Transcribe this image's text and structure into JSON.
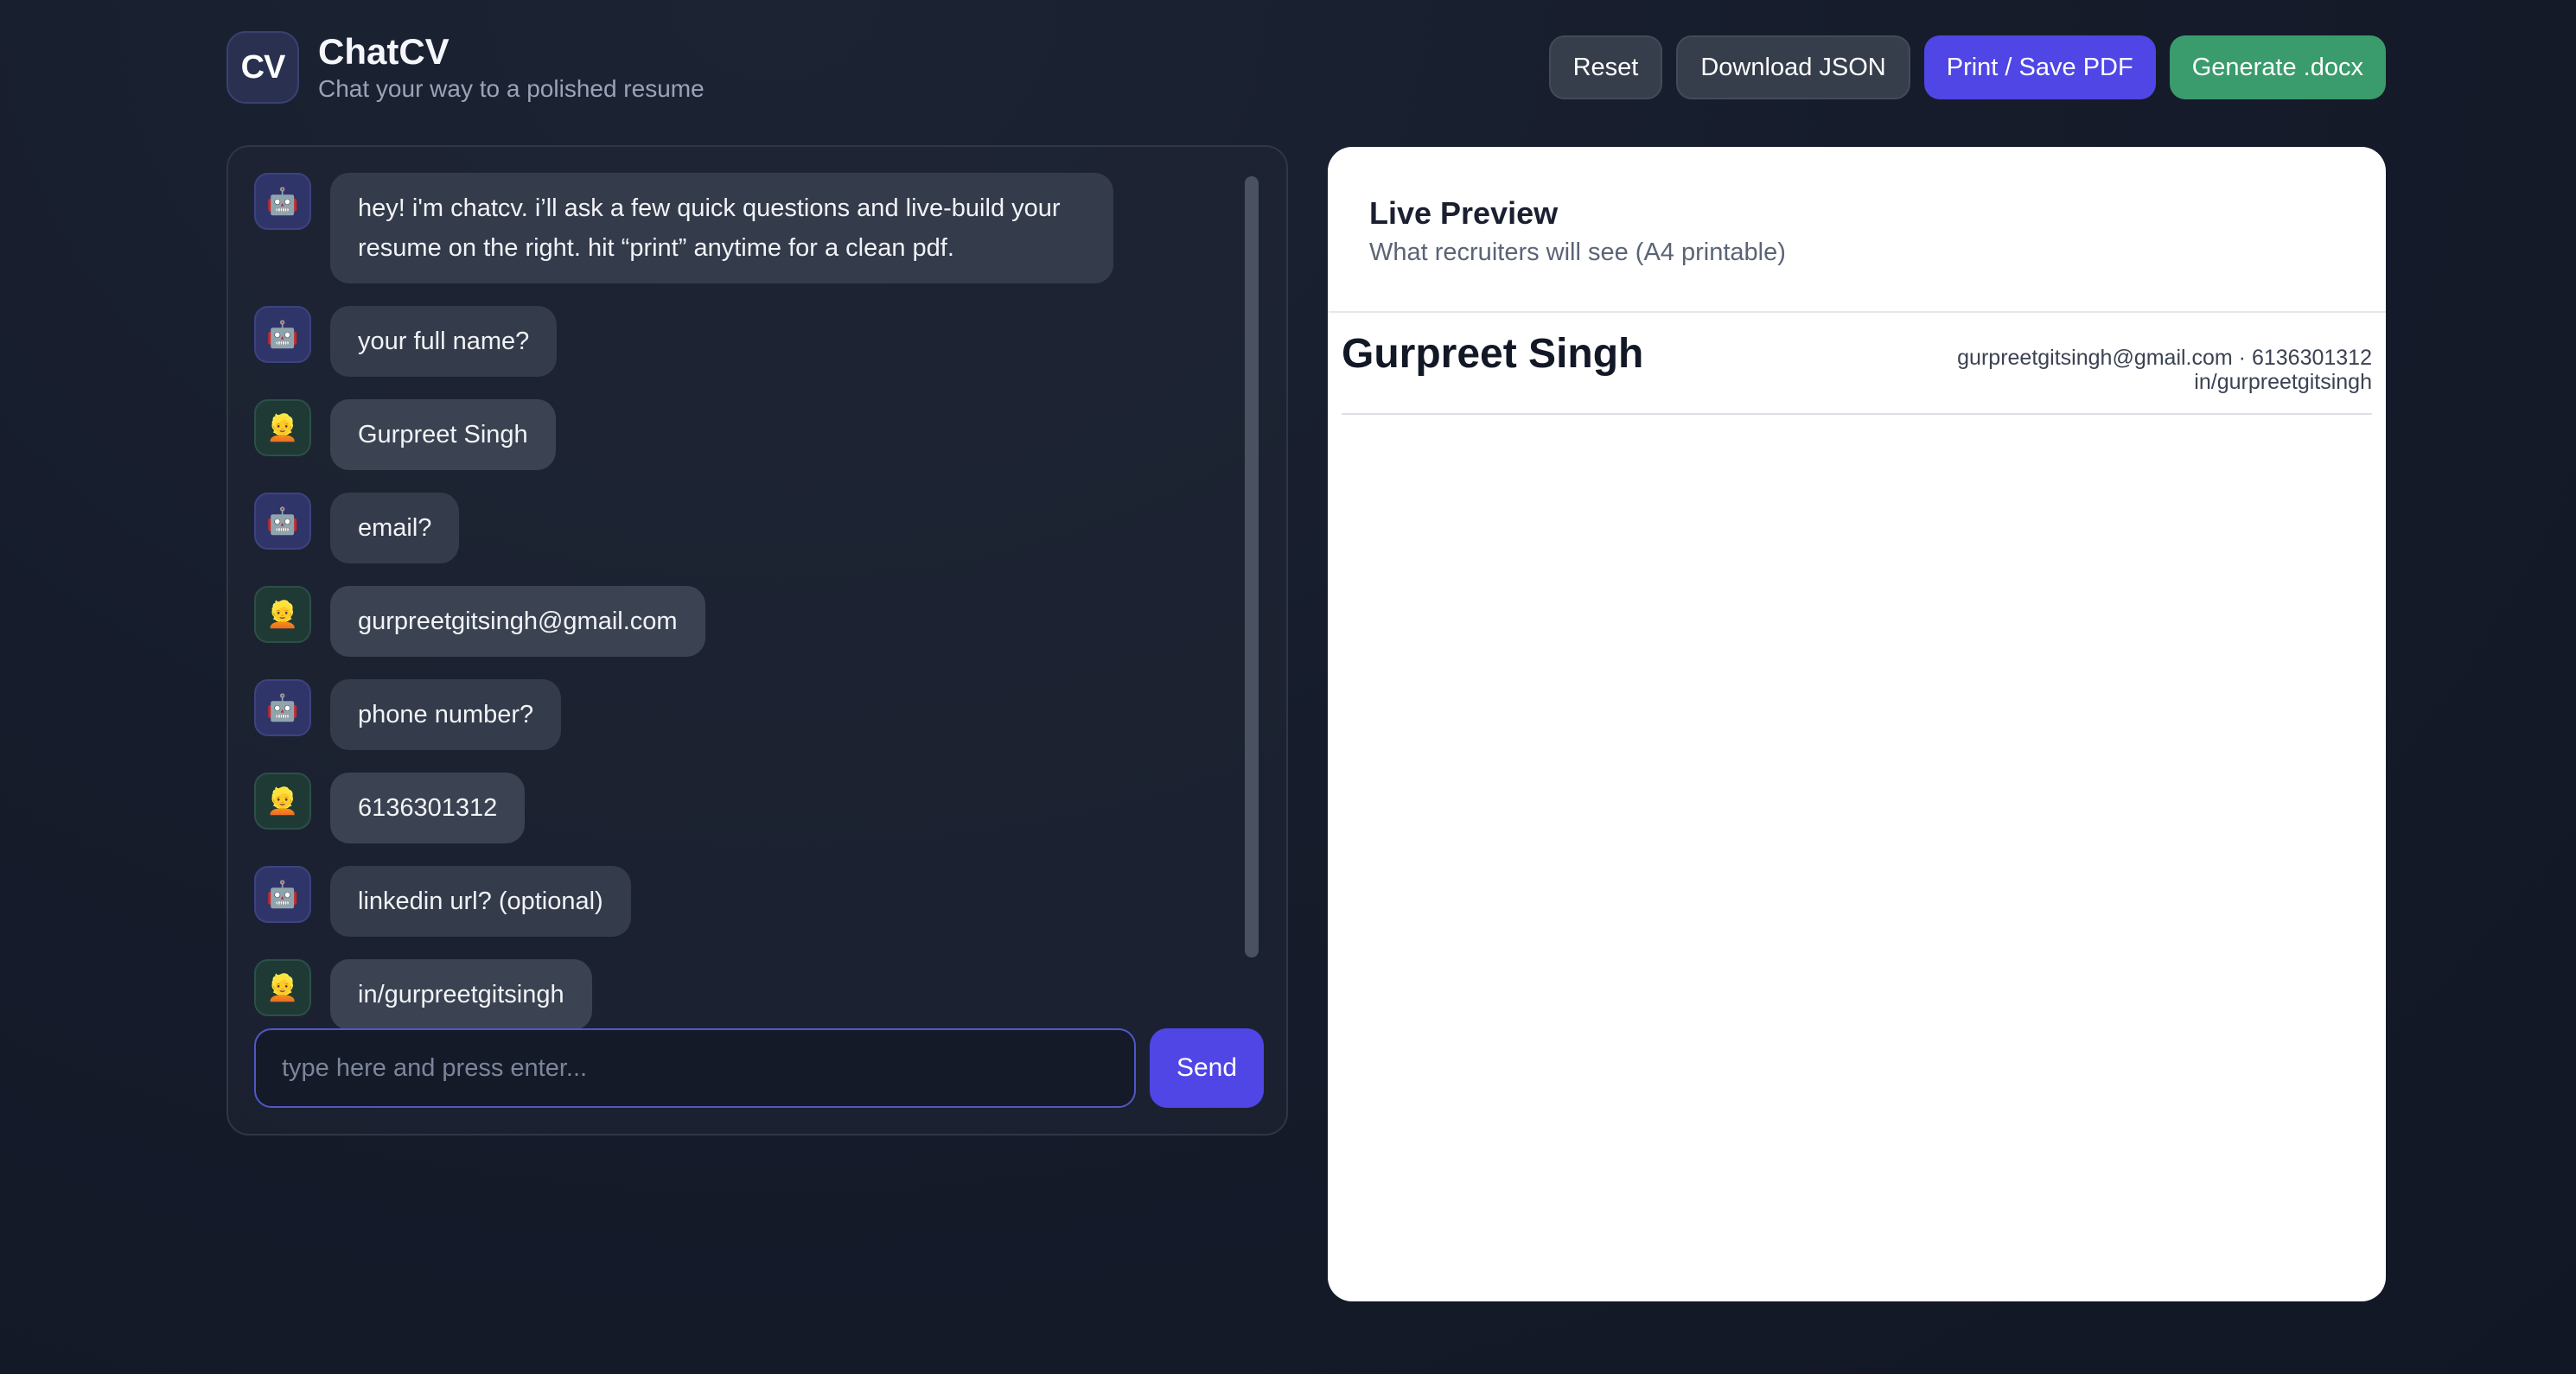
{
  "brand": {
    "logo_text": "CV",
    "title": "ChatCV",
    "subtitle": "Chat your way to a polished resume"
  },
  "toolbar": {
    "reset_label": "Reset",
    "download_label": "Download JSON",
    "print_label": "Print / Save PDF",
    "docx_label": "Generate .docx",
    "colors": {
      "dark": "#363d4b",
      "purple": "#4f46e5",
      "green": "#3a9b6d"
    }
  },
  "chat": {
    "messages": [
      {
        "role": "bot",
        "icon": "robot-icon",
        "emoji": "🤖",
        "text": "hey! i'm chatcv. i’ll ask a few quick questions and live-build your resume on the right. hit “print” anytime for a clean pdf."
      },
      {
        "role": "bot",
        "icon": "robot-icon",
        "emoji": "🤖",
        "text": "your full name?"
      },
      {
        "role": "user",
        "icon": "user-face-icon",
        "emoji": "👱",
        "text": "Gurpreet Singh"
      },
      {
        "role": "bot",
        "icon": "robot-icon",
        "emoji": "🤖",
        "text": "email?"
      },
      {
        "role": "user",
        "icon": "user-face-icon",
        "emoji": "👱",
        "text": "gurpreetgitsingh@gmail.com"
      },
      {
        "role": "bot",
        "icon": "robot-icon",
        "emoji": "🤖",
        "text": "phone number?"
      },
      {
        "role": "user",
        "icon": "user-face-icon",
        "emoji": "👱",
        "text": "6136301312"
      },
      {
        "role": "bot",
        "icon": "robot-icon",
        "emoji": "🤖",
        "text": "linkedin url? (optional)"
      },
      {
        "role": "user",
        "icon": "user-face-icon",
        "emoji": "👱",
        "text": "in/gurpreetgitsingh"
      }
    ],
    "input_placeholder": "type here and press enter...",
    "input_value": "",
    "send_label": "Send"
  },
  "preview": {
    "title": "Live Preview",
    "subtitle": "What recruiters will see (A4 printable)",
    "resume": {
      "name": "Gurpreet Singh",
      "contact_line1": "gurpreetgitsingh@gmail.com · 6136301312",
      "contact_line2": "in/gurpreetgitsingh"
    }
  }
}
